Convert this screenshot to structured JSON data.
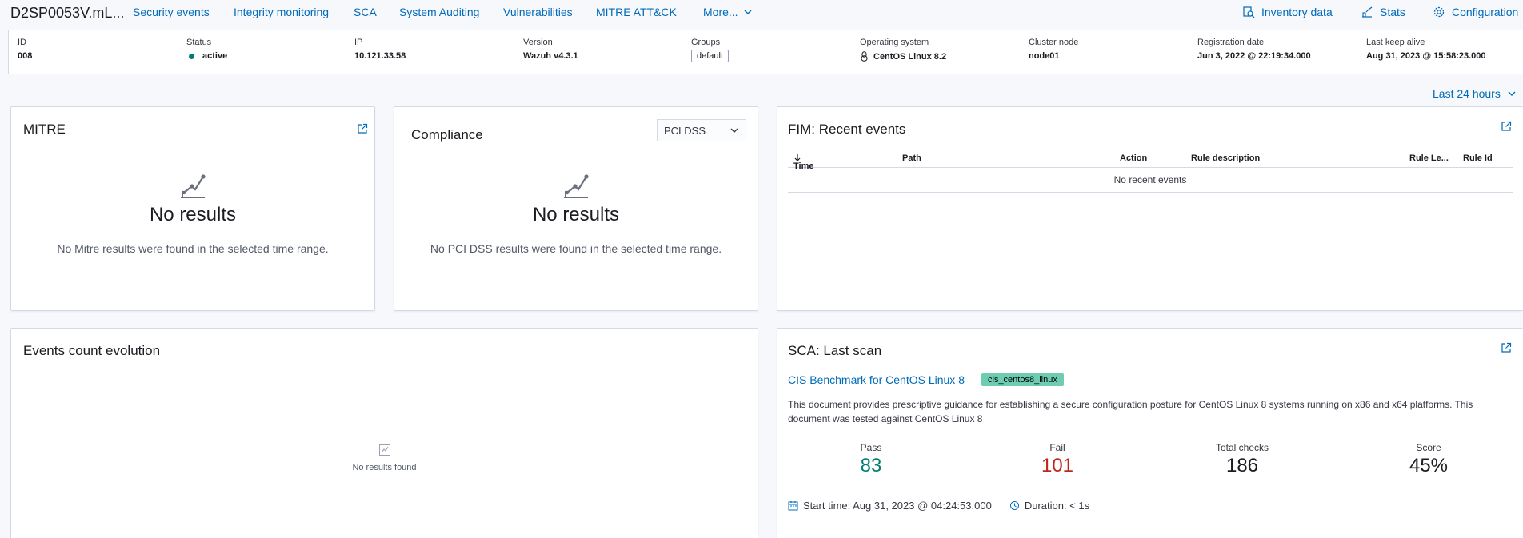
{
  "header": {
    "agent_name": "D2SP0053V.mL...",
    "tabs": [
      "Security events",
      "Integrity monitoring",
      "SCA",
      "System Auditing",
      "Vulnerabilities",
      "MITRE ATT&CK"
    ],
    "more_label": "More...",
    "right_links": {
      "inventory": "Inventory data",
      "stats": "Stats",
      "configuration": "Configuration"
    }
  },
  "agent_info": {
    "id": {
      "label": "ID",
      "value": "008"
    },
    "status": {
      "label": "Status",
      "value": "active",
      "color": "#017d73"
    },
    "ip": {
      "label": "IP",
      "value": "10.121.33.58"
    },
    "version": {
      "label": "Version",
      "value": "Wazuh v4.3.1"
    },
    "groups": {
      "label": "Groups",
      "value": "default"
    },
    "os": {
      "label": "Operating system",
      "value": "CentOS Linux 8.2",
      "icon": "linux-icon"
    },
    "cluster": {
      "label": "Cluster node",
      "value": "node01"
    },
    "registration": {
      "label": "Registration date",
      "value": "Jun 3, 2022 @ 22:19:34.000"
    },
    "keepalive": {
      "label": "Last keep alive",
      "value": "Aug 31, 2023 @ 15:58:23.000"
    }
  },
  "time_range": "Last 24 hours",
  "mitre": {
    "title": "MITRE",
    "empty_title": "No results",
    "empty_desc": "No Mitre results were found in the selected time range."
  },
  "compliance": {
    "title": "Compliance",
    "select_value": "PCI DSS",
    "empty_title": "No results",
    "empty_desc": "No PCI DSS results were found in the selected time range."
  },
  "fim": {
    "title": "FIM: Recent events",
    "columns": [
      "Time",
      "Path",
      "Action",
      "Rule description",
      "Rule Le...",
      "Rule Id"
    ],
    "empty": "No recent events"
  },
  "events": {
    "title": "Events count evolution",
    "empty": "No results found"
  },
  "sca": {
    "title": "SCA: Last scan",
    "benchmark": "CIS Benchmark for CentOS Linux 8",
    "policy_id": "cis_centos8_linux",
    "description": "This document provides prescriptive guidance for establishing a secure configuration posture for CentOS Linux 8 systems running on x86 and x64 platforms. This document was tested against CentOS Linux 8",
    "stats": {
      "pass": {
        "label": "Pass",
        "value": "83",
        "color": "#017d73"
      },
      "fail": {
        "label": "Fail",
        "value": "101",
        "color": "#bd271e"
      },
      "total": {
        "label": "Total checks",
        "value": "186",
        "color": "#1a1c21"
      },
      "score": {
        "label": "Score",
        "value": "45%",
        "color": "#1a1c21"
      }
    },
    "start_time": "Start time: Aug 31, 2023 @ 04:24:53.000",
    "duration": "Duration: < 1s"
  },
  "colors": {
    "accent": "#006bb8",
    "success": "#017d73",
    "danger": "#bd271e",
    "policy_badge": "#6dccb1"
  }
}
